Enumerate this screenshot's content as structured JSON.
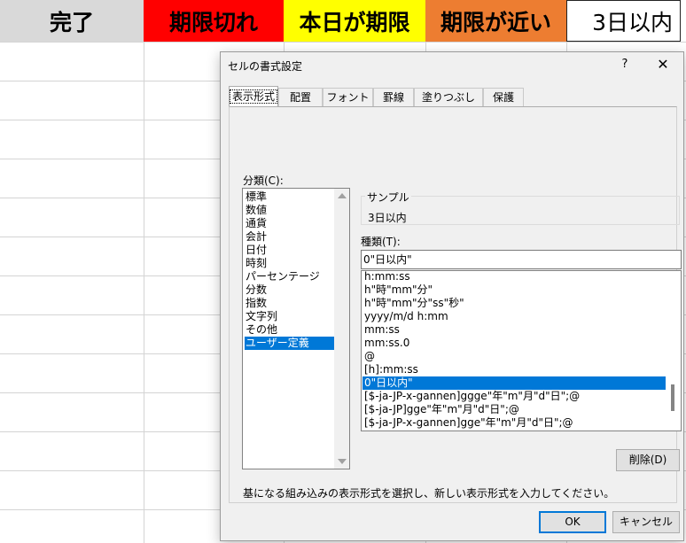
{
  "sheet": {
    "header_cells": [
      {
        "label": "完了",
        "bg": "#d9d9d9"
      },
      {
        "label": "期限切れ",
        "bg": "#ff0000"
      },
      {
        "label": "本日が期限",
        "bg": "#ffff00"
      },
      {
        "label": "期限が近い",
        "bg": "#ed7d31"
      },
      {
        "label": "3日以内",
        "bg": "#ffffff"
      }
    ]
  },
  "dialog": {
    "title": "セルの書式設定",
    "help": "?",
    "close": "✕",
    "tabs": [
      "表示形式",
      "配置",
      "フォント",
      "罫線",
      "塗りつぶし",
      "保護"
    ],
    "active_tab": "表示形式",
    "category_label": "分類(C):",
    "categories": [
      "標準",
      "数値",
      "通貨",
      "会計",
      "日付",
      "時刻",
      "パーセンテージ",
      "分数",
      "指数",
      "文字列",
      "その他",
      "ユーザー定義"
    ],
    "selected_category": "ユーザー定義",
    "sample_label": "サンプル",
    "sample_value": "3日以内",
    "type_label": "種類(T):",
    "type_value": "0\"日以内\"",
    "formats": [
      "h:mm:ss",
      "h\"時\"mm\"分\"",
      "h\"時\"mm\"分\"ss\"秒\"",
      "yyyy/m/d h:mm",
      "mm:ss",
      "mm:ss.0",
      "@",
      "[h]:mm:ss",
      "0\"日以内\"",
      "[$-ja-JP-x-gannen]ggge\"年\"m\"月\"d\"日\";@",
      "[$-ja-JP]gge\"年\"m\"月\"d\"日\";@",
      "[$-ja-JP-x-gannen]gge\"年\"m\"月\"d\"日\";@"
    ],
    "selected_format": "0\"日以内\"",
    "delete_button": "削除(D)",
    "description": "基になる組み込みの表示形式を選択し、新しい表示形式を入力してください。",
    "ok_button": "OK",
    "cancel_button": "キャンセル"
  }
}
